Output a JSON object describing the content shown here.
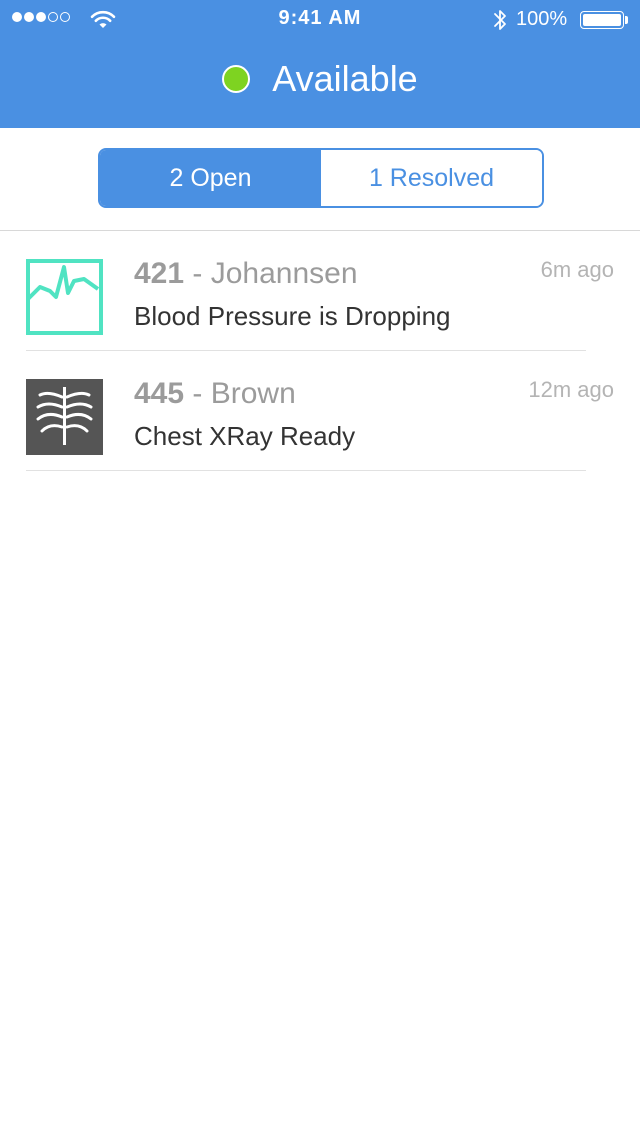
{
  "status_bar": {
    "time": "9:41 AM",
    "battery": "100%",
    "signal_bars_filled": 3,
    "signal_bars_total": 5
  },
  "header": {
    "status_label": "Available",
    "status_color": "#7ed321",
    "background_color": "#4a90e2"
  },
  "tabs": [
    {
      "label": "2 Open",
      "active": true
    },
    {
      "label": "1 Resolved",
      "active": false
    }
  ],
  "items": [
    {
      "number": "421",
      "separator": " - ",
      "name": "Johannsen",
      "message": "Blood Pressure is Dropping",
      "time": "6m ago",
      "icon": "chart-line-icon",
      "icon_color": "#50e3c2"
    },
    {
      "number": "445",
      "separator": " - ",
      "name": "Brown",
      "message": "Chest XRay Ready",
      "time": "12m ago",
      "icon": "xray-ribcage-icon",
      "icon_color": "#555555"
    }
  ]
}
